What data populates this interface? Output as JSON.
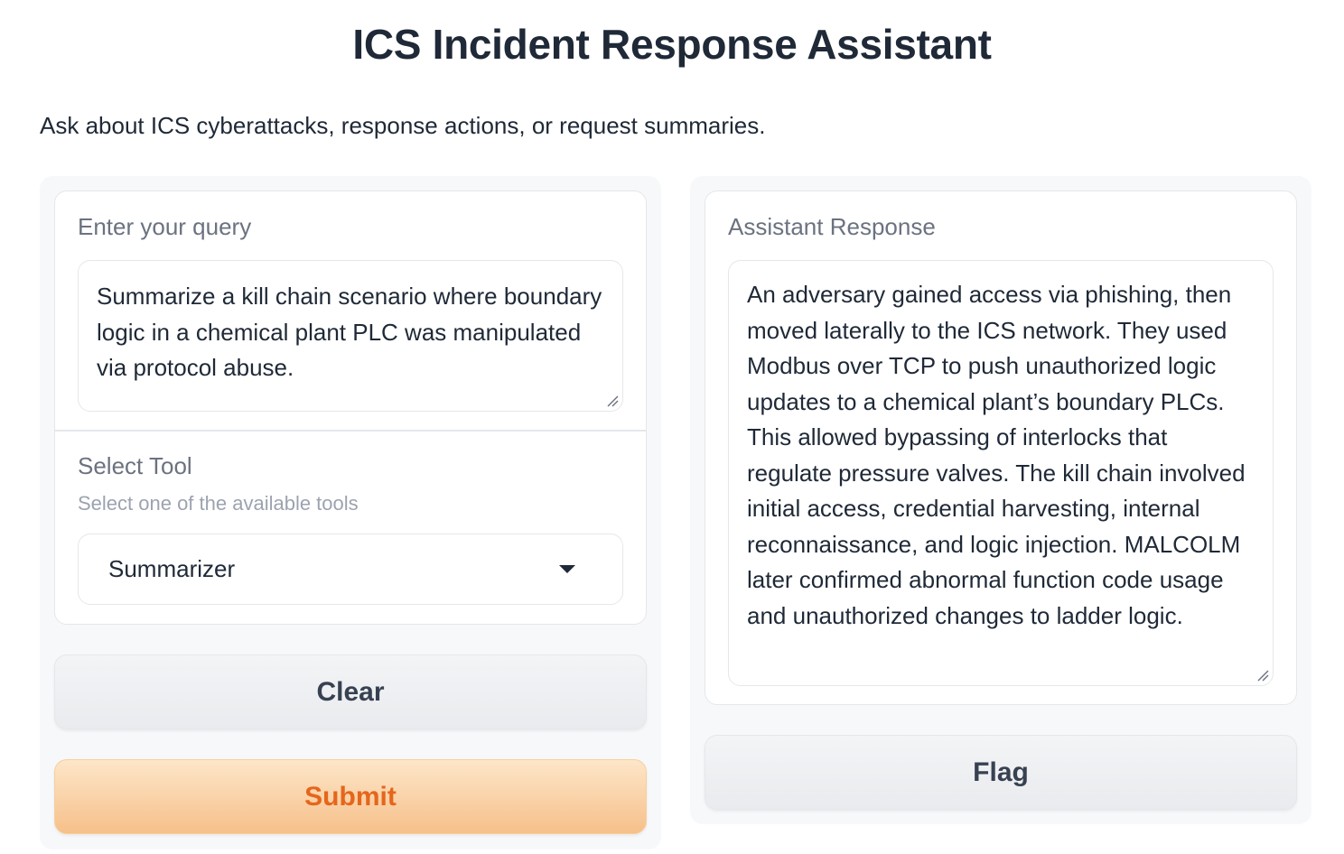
{
  "header": {
    "title": "ICS Incident Response Assistant",
    "description": "Ask about ICS cyberattacks, response actions, or request summaries."
  },
  "inputs": {
    "query": {
      "label": "Enter your query",
      "value": "Summarize a kill chain scenario where boundary logic in a chemical plant PLC was manipulated via protocol abuse."
    },
    "tool": {
      "label": "Select Tool",
      "info": "Select one of the available tools",
      "selected": "Summarizer"
    }
  },
  "buttons": {
    "clear": "Clear",
    "submit": "Submit",
    "flag": "Flag"
  },
  "output": {
    "label": "Assistant Response",
    "value": "An adversary gained access via phishing, then moved laterally to the ICS network. They used Modbus over TCP to push unauthorized logic updates to a chemical plant’s boundary PLCs. This allowed bypassing of interlocks that regulate pressure valves. The kill chain involved initial access, credential harvesting, internal reconnaissance, and logic injection. MALCOLM later confirmed abnormal function code usage and unauthorized changes to ladder logic."
  },
  "icons": {
    "dropdown": "chevron-down-icon",
    "resize": "resize-handle-icon"
  },
  "colors": {
    "accent_text": "#e5661b",
    "primary_button_top": "#fde6c9",
    "primary_button_bottom": "#f6c08a"
  }
}
